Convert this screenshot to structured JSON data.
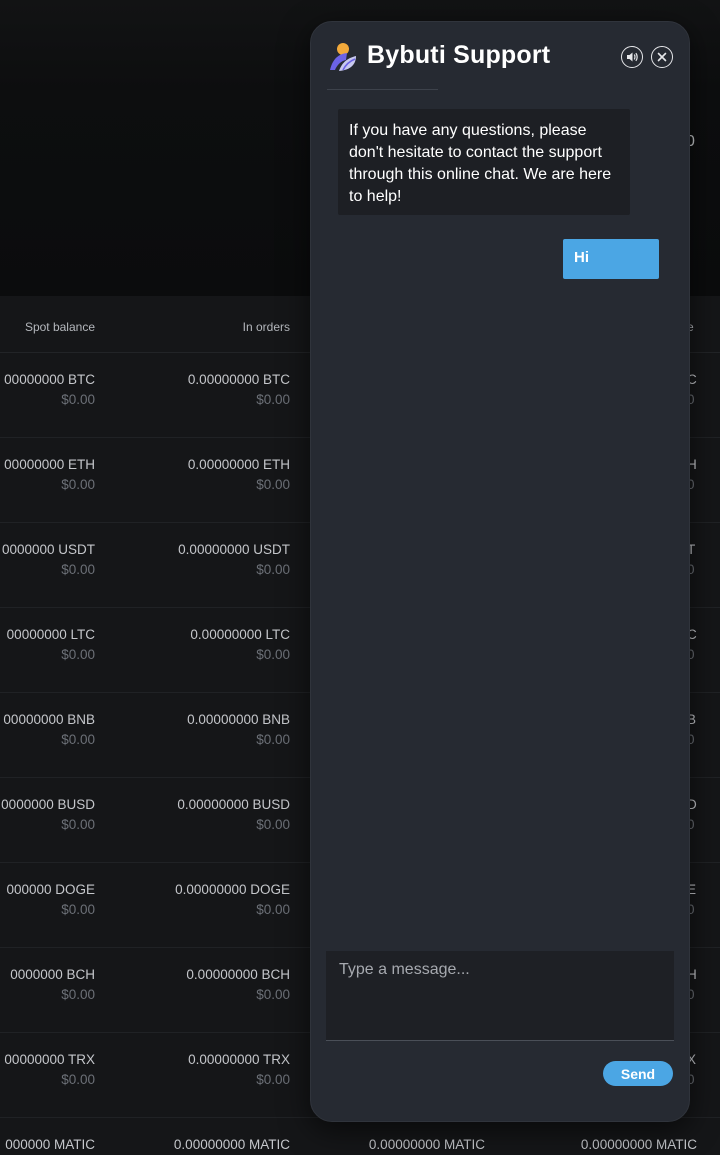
{
  "background": {
    "header_cut_value": "0",
    "columns": {
      "spot": "Spot balance",
      "orders": "In orders",
      "cut": "e"
    },
    "rows": [
      {
        "spot": "00000000 BTC",
        "spot_usd": "$0.00",
        "orders": "0.00000000 BTC",
        "orders_usd": "$0.00",
        "cut": "C",
        "cut_usd": "0"
      },
      {
        "spot": "00000000 ETH",
        "spot_usd": "$0.00",
        "orders": "0.00000000 ETH",
        "orders_usd": "$0.00",
        "cut": "H",
        "cut_usd": "0"
      },
      {
        "spot": "0000000 USDT",
        "spot_usd": "$0.00",
        "orders": "0.00000000 USDT",
        "orders_usd": "$0.00",
        "cut": "T",
        "cut_usd": "0"
      },
      {
        "spot": "00000000 LTC",
        "spot_usd": "$0.00",
        "orders": "0.00000000 LTC",
        "orders_usd": "$0.00",
        "cut": "C",
        "cut_usd": "0"
      },
      {
        "spot": "00000000 BNB",
        "spot_usd": "$0.00",
        "orders": "0.00000000 BNB",
        "orders_usd": "$0.00",
        "cut": "B",
        "cut_usd": "0"
      },
      {
        "spot": "0000000 BUSD",
        "spot_usd": "$0.00",
        "orders": "0.00000000 BUSD",
        "orders_usd": "$0.00",
        "cut": "D",
        "cut_usd": "0"
      },
      {
        "spot": "000000 DOGE",
        "spot_usd": "$0.00",
        "orders": "0.00000000 DOGE",
        "orders_usd": "$0.00",
        "cut": "E",
        "cut_usd": "0"
      },
      {
        "spot": "0000000 BCH",
        "spot_usd": "$0.00",
        "orders": "0.00000000 BCH",
        "orders_usd": "$0.00",
        "cut": "H",
        "cut_usd": "0"
      },
      {
        "spot": "00000000 TRX",
        "spot_usd": "$0.00",
        "orders": "0.00000000 TRX",
        "orders_usd": "$0.00",
        "cut": "X",
        "cut_usd": "0"
      }
    ],
    "last_row": {
      "spot": "000000 MATIC",
      "orders": "0.00000000 MATIC",
      "c3": "0.00000000 MATIC",
      "c4": "0.00000000 MATIC"
    }
  },
  "chat": {
    "title": "Bybuti Support",
    "logo_icon": "bybuti-logo-icon",
    "sound_icon": "speaker-icon",
    "close_icon": "close-icon",
    "messages": [
      {
        "from": "agent",
        "text": "If you have any questions, please don't hesitate to contact the support through this online chat. We are here to help!"
      },
      {
        "from": "user",
        "text": "Hi"
      }
    ],
    "input_placeholder": "Type a message...",
    "input_value": "",
    "send_label": "Send",
    "colors": {
      "panel": "#262a32",
      "bubble_in": "#1d1f24",
      "bubble_out": "#4ba6e4",
      "accent": "#4ba6e4"
    }
  }
}
